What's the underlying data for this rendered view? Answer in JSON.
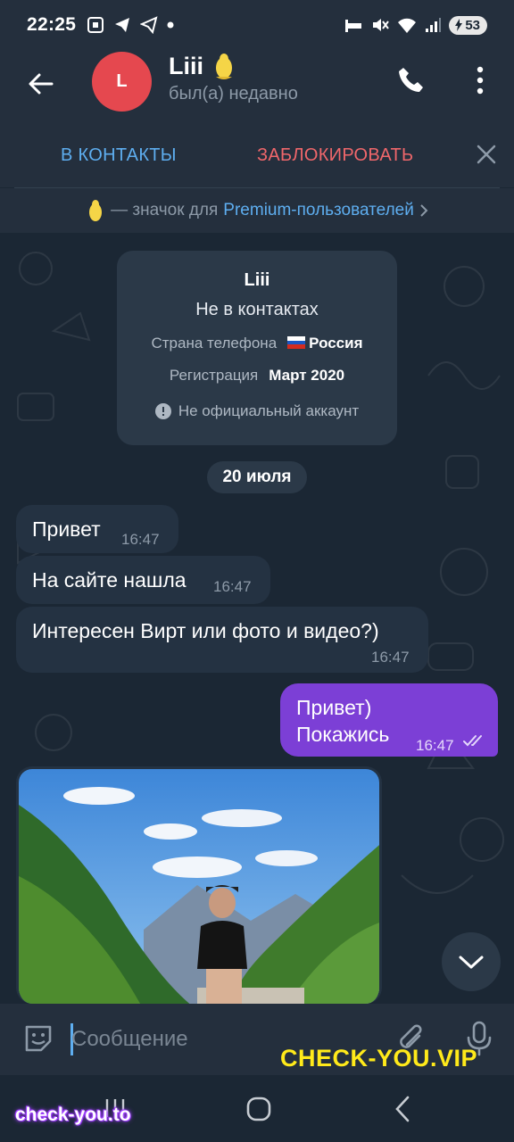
{
  "status_bar": {
    "time": "22:25",
    "battery": "53",
    "left_icons": [
      "screenshot-icon",
      "telegram-icon",
      "telegram-icon",
      "dot-icon"
    ],
    "right_icons": [
      "alarm-icon",
      "mute-icon",
      "wifi-icon",
      "signal-icon",
      "battery-icon"
    ]
  },
  "header": {
    "avatar_letter": "L",
    "avatar_color": "#e5484f",
    "name": "Liii",
    "status": "был(а) недавно"
  },
  "actions": {
    "add_contact": "В КОНТАКТЫ",
    "block": "ЗАБЛОКИРОВАТЬ"
  },
  "premium_bar": {
    "text": "— значок для",
    "link": "Premium-пользователей"
  },
  "info_card": {
    "name": "Liii",
    "status": "Не в контактах",
    "phone_country_label": "Страна телефона",
    "phone_country_value": "Россия",
    "registration_label": "Регистрация",
    "registration_value": "Март 2020",
    "warning": "Не официальный аккаунт"
  },
  "date_separator": "20 июля",
  "messages_in": [
    {
      "text": "Привет",
      "time": "16:47"
    },
    {
      "text": "На сайте нашла",
      "time": "16:47"
    },
    {
      "text": "Интересен Вирт или фото и видео?)",
      "time": "16:47"
    }
  ],
  "message_out": {
    "line1": "Привет)",
    "line2": "Покажись",
    "time": "16:47"
  },
  "composer": {
    "placeholder": "Сообщение"
  },
  "watermarks": {
    "yellow": "CHECK-YOU.VIP",
    "bottom": "check-you.to"
  },
  "colors": {
    "accent": "#5eaef0",
    "danger": "#f0676b",
    "outgoing": "#7c3fd6",
    "background": "#1b2734",
    "panel": "#242f3d"
  }
}
